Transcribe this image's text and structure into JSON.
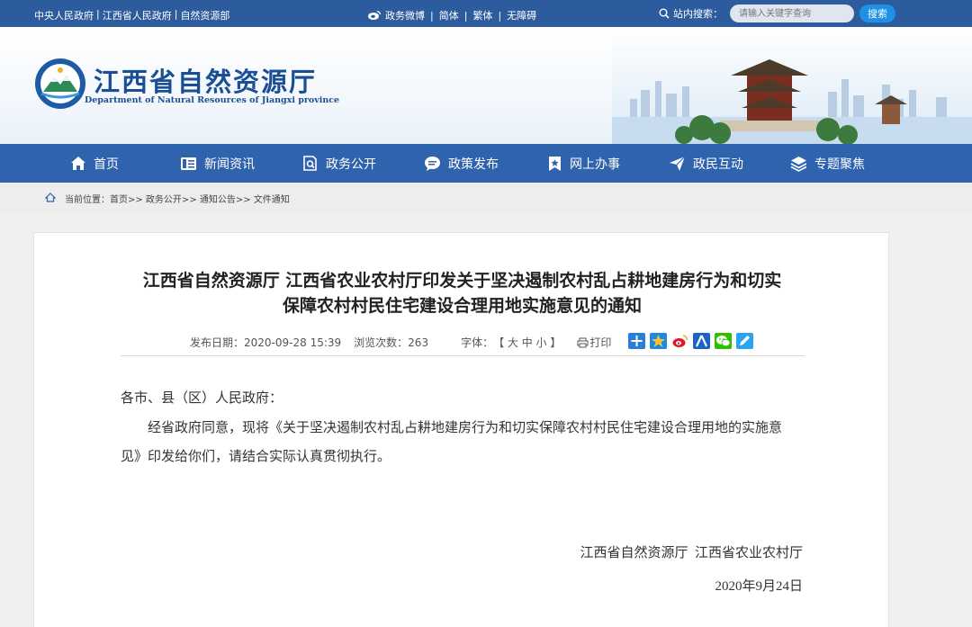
{
  "topbar": {
    "links": [
      "中央人民政府",
      "江西省人民政府",
      "自然资源部"
    ],
    "weibo": "政务微博",
    "simplified": "简体",
    "traditional": "繁体",
    "accessible": "无障碍",
    "search_label": "站内搜索：",
    "search_placeholder": "请输入关键字查询",
    "search_button": "搜索"
  },
  "banner": {
    "title": "江西省自然资源厅",
    "subtitle": "Department of Natural Resources of Jiangxi province"
  },
  "nav": [
    {
      "label": "首页",
      "icon": "home-icon"
    },
    {
      "label": "新闻资讯",
      "icon": "news-icon"
    },
    {
      "label": "政务公开",
      "icon": "document-search-icon"
    },
    {
      "label": "政策发布",
      "icon": "chat-icon"
    },
    {
      "label": "网上办事",
      "icon": "bookmark-icon"
    },
    {
      "label": "政民互动",
      "icon": "send-icon"
    },
    {
      "label": "专题聚焦",
      "icon": "layers-icon"
    }
  ],
  "breadcrumb": {
    "label": "当前位置：",
    "items": [
      "首页",
      "政务公开",
      "通知公告",
      "文件通知"
    ],
    "text": "当前位置：首页>> 政务公开>> 通知公告>> 文件通知"
  },
  "article": {
    "title_line1": "江西省自然资源厅 江西省农业农村厅印发关于坚决遏制农村乱占耕地建房行为和切实",
    "title_line2": "保障农村村民住宅建设合理用地实施意见的通知",
    "publish_label": "发布日期：",
    "publish_date": "2020-09-28 15:39",
    "views_label": "浏览次数：",
    "views": "263",
    "font_label": "字体：",
    "font_sizes": "【 大 中 小 】",
    "print": "打印",
    "greeting": "各市、县（区）人民政府：",
    "para_line1": "经省政府同意，现将《关于坚决遏制农村乱占耕地建房行为和切实保障农村村民住宅建设合理用地的实施意",
    "para_line2": "见》印发给你们，请结合实际认真贯彻执行。",
    "signature": "江西省自然资源厅  江西省农业农村厅",
    "date": "2020年9月24日"
  },
  "colors": {
    "topbar": "#2d5c9e",
    "nav": "#2f63ad",
    "brand": "#1a4f96",
    "search_button": "#1e90e6"
  }
}
